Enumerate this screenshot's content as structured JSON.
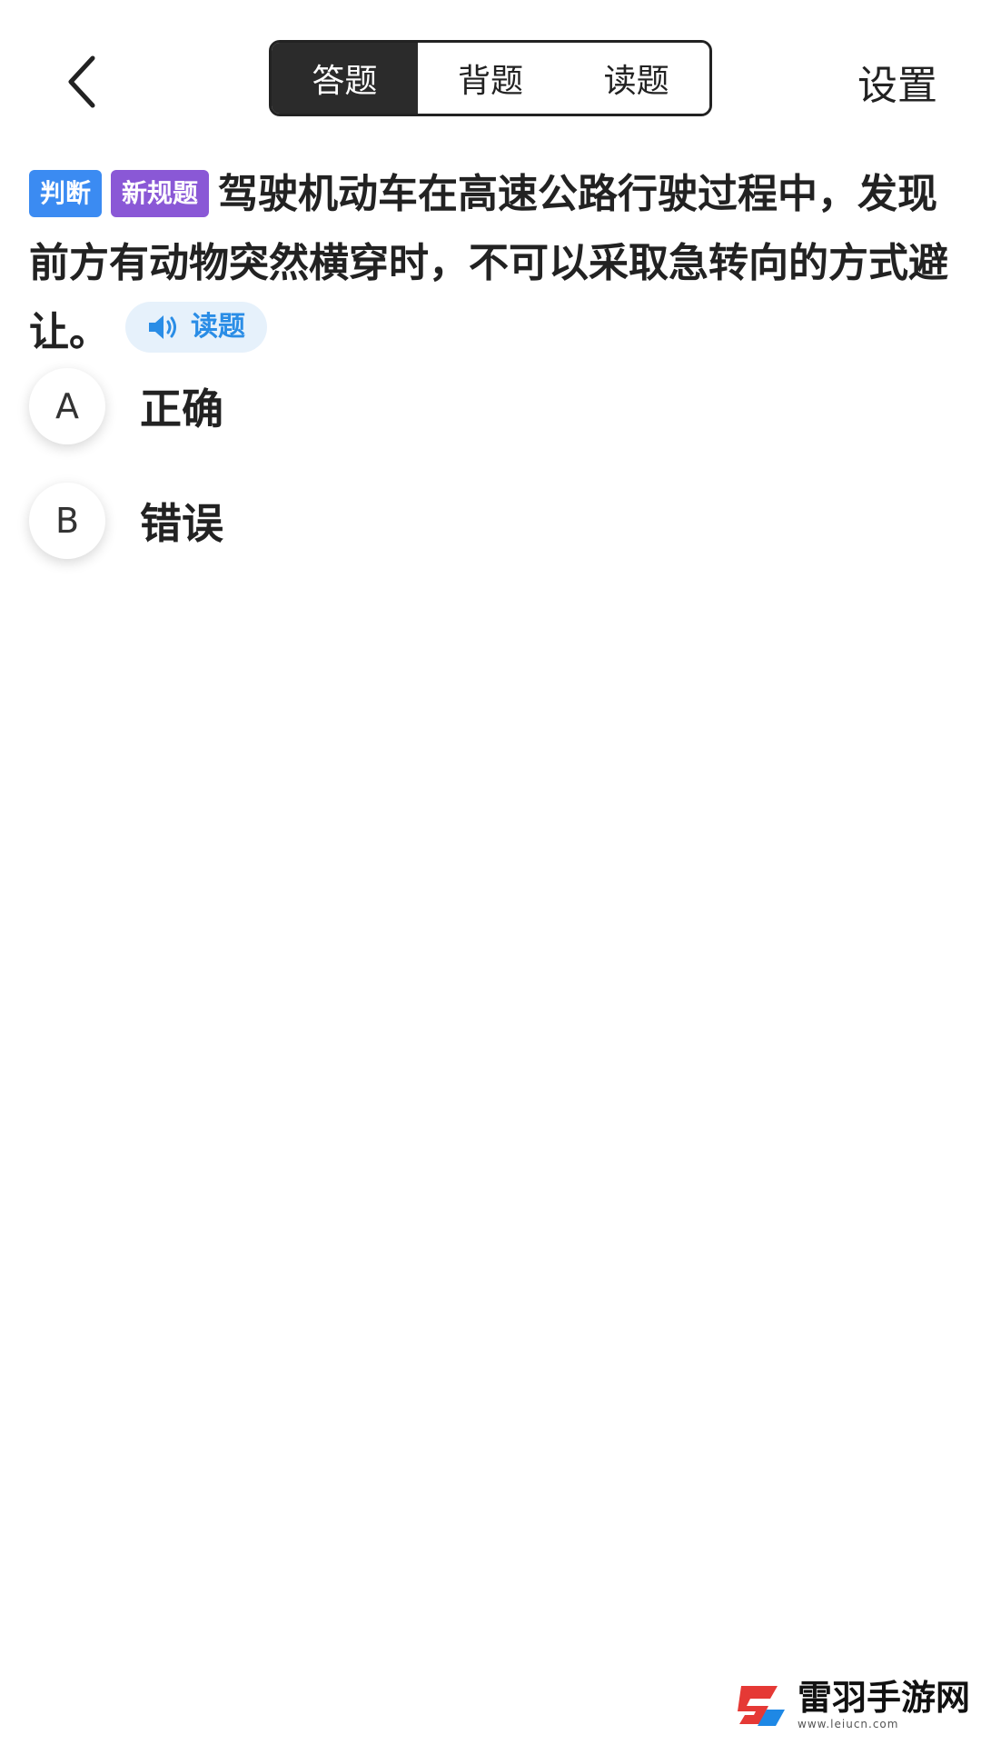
{
  "header": {
    "tabs": [
      {
        "label": "答题",
        "active": true
      },
      {
        "label": "背题",
        "active": false
      },
      {
        "label": "读题",
        "active": false
      }
    ],
    "settings_label": "设置",
    "back_icon": "chevron-left-icon"
  },
  "question": {
    "tags": [
      {
        "label": "判断",
        "color": "#3b8bf2"
      },
      {
        "label": "新规题",
        "color": "#8a58d6"
      }
    ],
    "text": "驾驶机动车在高速公路行驶过程中，发现前方有动物突然横穿时，不可以采取急转向的方式避让。",
    "read_button_label": "读题",
    "read_icon": "speaker-icon"
  },
  "options": [
    {
      "letter": "A",
      "text": "正确"
    },
    {
      "letter": "B",
      "text": "错误"
    }
  ],
  "watermark": {
    "name": "雷羽手游网",
    "url": "www.leiucn.com"
  },
  "colors": {
    "active_tab_bg": "#2b2b2b",
    "read_chip_bg": "#e6f1fb",
    "read_chip_text": "#2a8de6"
  }
}
